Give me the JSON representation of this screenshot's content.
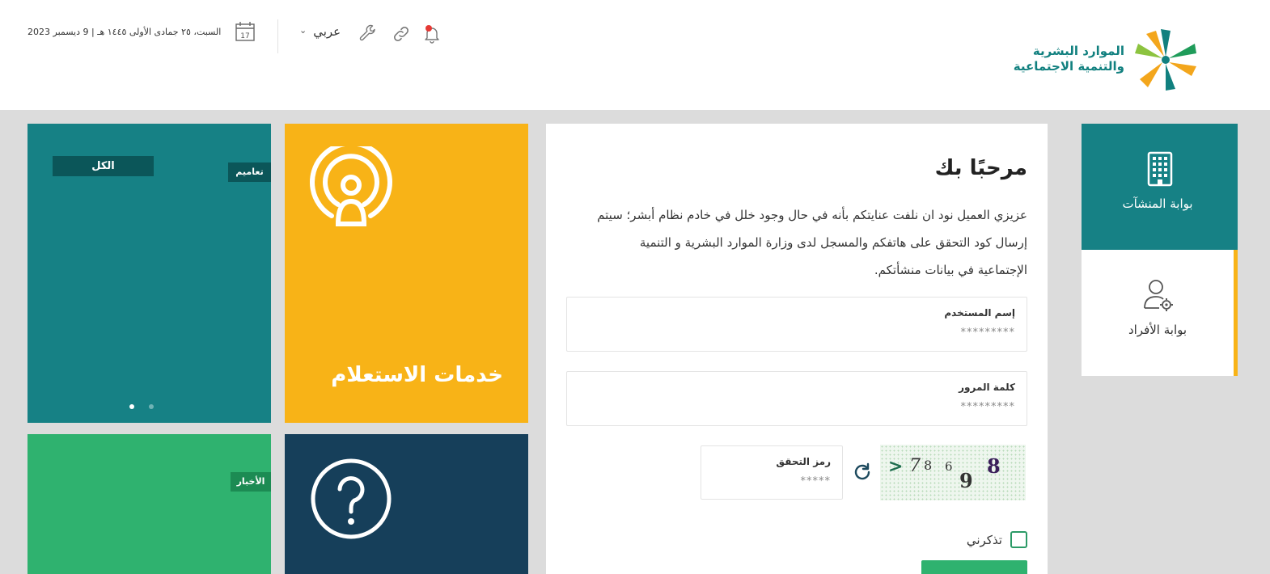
{
  "header": {
    "logo_line1": "الموارد البشرية",
    "logo_line2": "والتنمية الاجتماعية",
    "logo_icon": "hrsd-star-logo",
    "date": "السبت، ٢٥ جمادى الأولى ١٤٤٥ هـ | 9 ديسمبر 2023",
    "calendar_day": "17",
    "language_label": "عربي",
    "icons": [
      "calendar-icon",
      "chevron-down-icon",
      "wrench-icon",
      "link-icon",
      "bell-icon"
    ]
  },
  "tiles": {
    "all_label": "الكل",
    "circulars_label": "تعاميم",
    "news_label": "الأخبار",
    "inquiry_title": "خدمات الاستعلام",
    "inquiry_icon": "podcast-user-icon",
    "help_icon": "question-circle-icon",
    "colors": {
      "teal": "#168185",
      "yellow": "#f8b317",
      "green": "#2fb26f",
      "navy": "#163f5a"
    }
  },
  "login": {
    "welcome": "مرحبًا بك",
    "intro_line1": "عزيزي العميل نود ان نلفت عنايتكم بأنه في حال وجود خلل في خادم نظام أبشر؛ سيتم",
    "intro_line2": "إرسال كود التحقق على هاتفكم والمسجل لدى وزارة الموارد البشرية و التنمية",
    "intro_line3": "الإجتماعية في بيانات منشأتكم.",
    "username_label": "إسم المستخدم",
    "username_value": "*********",
    "password_label": "كلمة المرور",
    "password_value": "*********",
    "code_label": "رمز التحقق",
    "code_value": "*****",
    "captcha_chars": [
      ">",
      "7",
      "8",
      "6",
      "9",
      "8"
    ],
    "remember_label": "تذكرني",
    "refresh_icon": "refresh-icon"
  },
  "portals": {
    "establishments_label": "بوابة المنشآت",
    "individuals_label": "بوابة الأفراد"
  }
}
